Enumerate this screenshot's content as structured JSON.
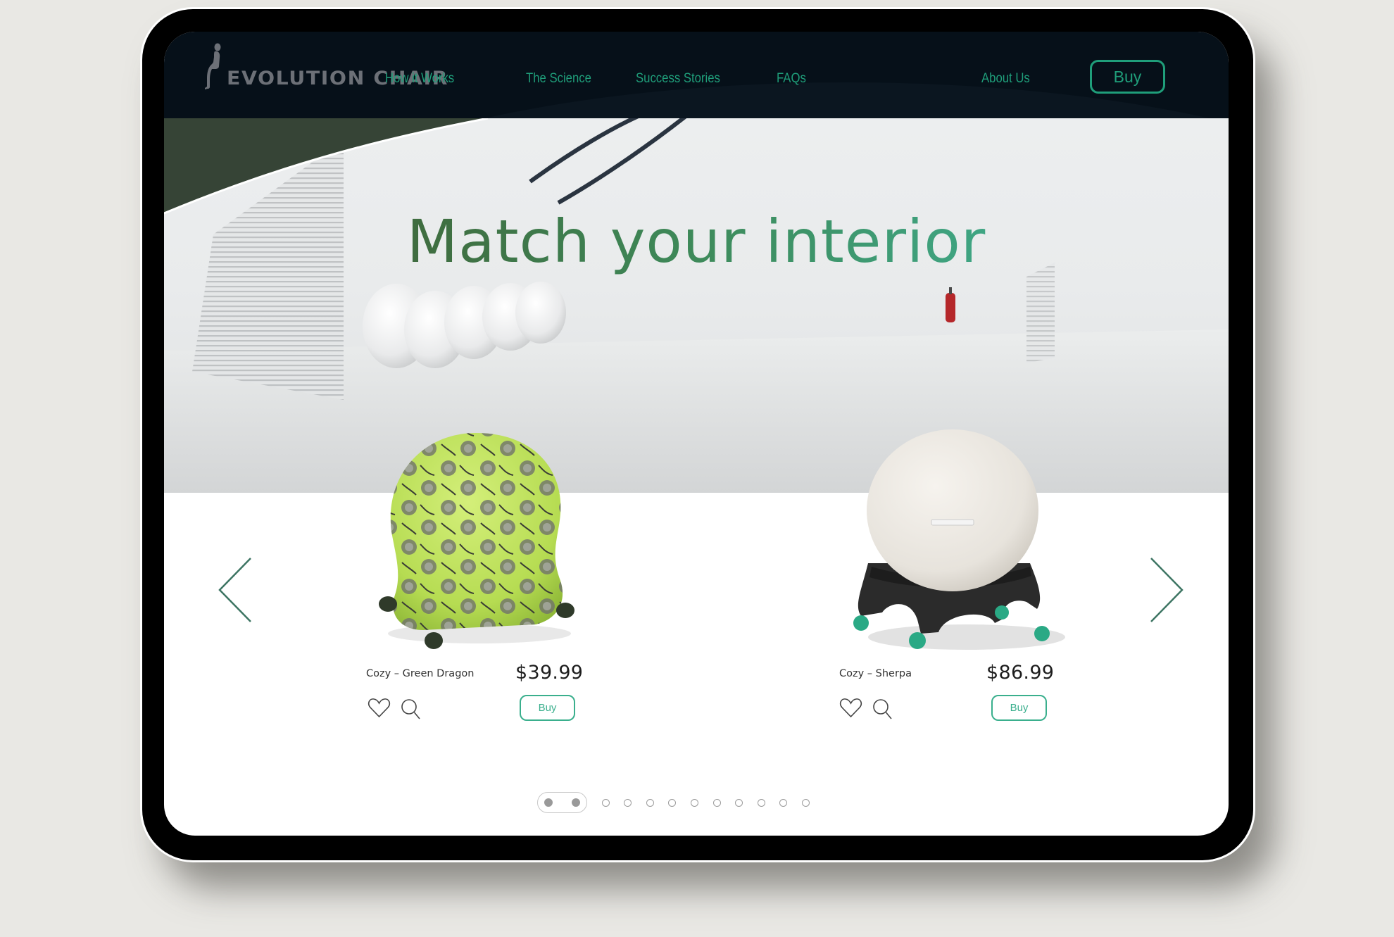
{
  "brand": {
    "name": "EVOLUTION CHAIR",
    "logo_icon": "seated-figure-icon"
  },
  "nav": {
    "items": [
      {
        "label": "How it Works"
      },
      {
        "label": "The Science"
      },
      {
        "label": "Success Stories"
      },
      {
        "label": "FAQs"
      },
      {
        "label": "About Us"
      }
    ],
    "buy_label": "Buy"
  },
  "hero": {
    "headline": "Match your interior",
    "background": "white gallery hallway with white balloons and red fire extinguisher"
  },
  "carousel": {
    "prev_icon": "chevron-left-icon",
    "next_icon": "chevron-right-icon",
    "products": [
      {
        "name": "Cozy – Green Dragon",
        "price": "$39.99",
        "buy_label": "Buy",
        "image": "green patterned ball chair on casters",
        "wishlist_icon": "heart-icon",
        "zoom_icon": "search-icon"
      },
      {
        "name": "Cozy – Sherpa",
        "price": "$86.99",
        "buy_label": "Buy",
        "image": "white sherpa ball chair on black base with green wheels",
        "wishlist_icon": "heart-icon",
        "zoom_icon": "search-icon"
      }
    ]
  },
  "pagination": {
    "total_dots": 12,
    "active_dots": [
      1,
      2
    ]
  },
  "colors": {
    "header_bg": "#061019",
    "accent": "#1f9e7a",
    "headline_start": "#3f6c3f",
    "headline_end": "#3fa583",
    "hero_corner_green": "#364436",
    "arrow": "#3c7462"
  }
}
